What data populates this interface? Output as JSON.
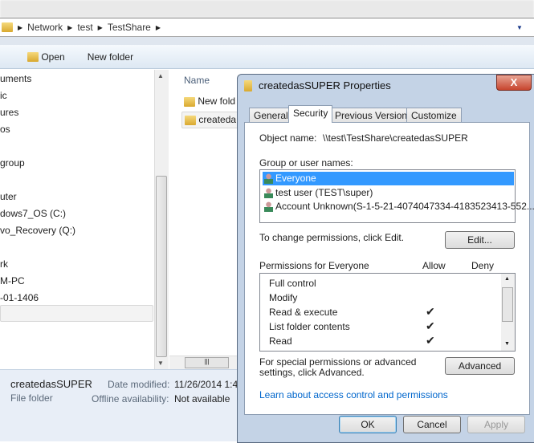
{
  "address": {
    "crumbs": [
      "Network",
      "test",
      "TestShare"
    ]
  },
  "toolbar": {
    "open": "Open",
    "new_folder": "New folder"
  },
  "nav": [
    "uments",
    "ic",
    "ures",
    "os",
    "group",
    "uter",
    "dows7_OS (C:)",
    "vo_Recovery (Q:)",
    "rk",
    "M-PC",
    "-01-1406"
  ],
  "content": {
    "header": "Name",
    "items": [
      "New fold",
      "createda"
    ]
  },
  "details": {
    "name": "createdasSUPER",
    "type": "File folder",
    "date_label": "Date modified:",
    "date_value": "11/26/2014 1:4",
    "offline_label": "Offline availability:",
    "offline_value": "Not available"
  },
  "dialog": {
    "title": "createdasSUPER Properties",
    "close": "X",
    "tabs": [
      "General",
      "Security",
      "Previous Versions",
      "Customize"
    ],
    "object_label": "Object name:",
    "object_value": "\\\\test\\TestShare\\createdasSUPER",
    "group_label": "Group or user names:",
    "users": [
      "Everyone",
      "test user (TEST\\super)",
      "Account Unknown(S-1-5-21-4074047334-4183523413-552..."
    ],
    "change_text": "To change permissions, click Edit.",
    "edit": "Edit...",
    "perm_label": "Permissions for Everyone",
    "allow": "Allow",
    "deny": "Deny",
    "perms": [
      {
        "name": "Full control",
        "allow": false
      },
      {
        "name": "Modify",
        "allow": false
      },
      {
        "name": "Read & execute",
        "allow": true
      },
      {
        "name": "List folder contents",
        "allow": true
      },
      {
        "name": "Read",
        "allow": true
      }
    ],
    "special_text": "For special permissions or advanced settings, click Advanced.",
    "advanced": "Advanced",
    "link": "Learn about access control and permissions",
    "ok": "OK",
    "cancel": "Cancel",
    "apply": "Apply"
  },
  "checkmark": "✔"
}
